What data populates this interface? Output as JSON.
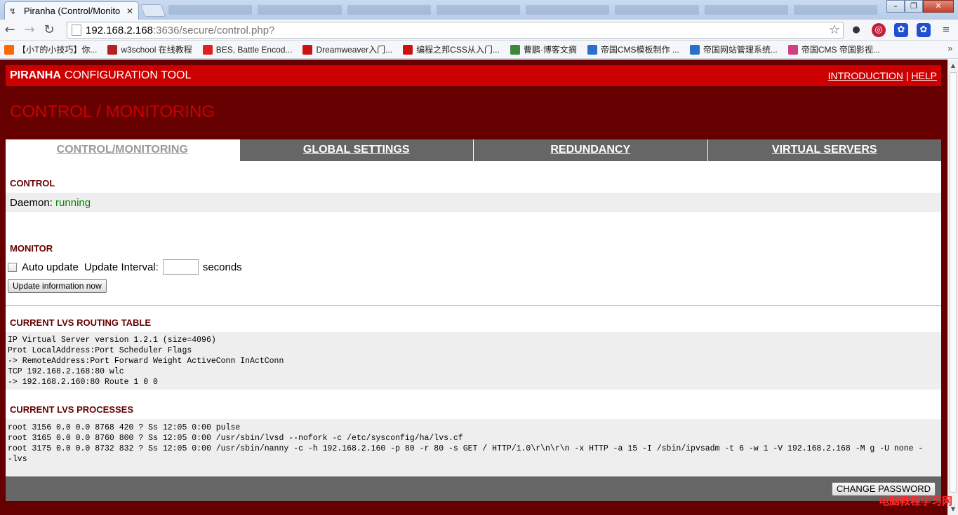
{
  "browser": {
    "tab_title": "Piranha (Control/Monito",
    "url_host": "192.168.2.168",
    "url_rest": ":3636/secure/control.php?"
  },
  "bookmarks": [
    {
      "label": "【小T的小技巧】你...",
      "color": "#ff6600"
    },
    {
      "label": "w3school 在线教程",
      "color": "#b22222"
    },
    {
      "label": "BES, Battle Encod...",
      "color": "#e02020"
    },
    {
      "label": "Dreamweaver入门...",
      "color": "#cc1111"
    },
    {
      "label": "编程之邦CSS从入门...",
      "color": "#cc1111"
    },
    {
      "label": "曹鹏·博客文摘",
      "color": "#3a8a3a"
    },
    {
      "label": "帝国CMS模板制作 ...",
      "color": "#2a6fd0"
    },
    {
      "label": "帝国网站管理系统...",
      "color": "#2a6fd0"
    },
    {
      "label": "帝国CMS 帝国影视...",
      "color": "#d04080"
    }
  ],
  "header": {
    "brand": "PIRANHA",
    "title": "CONFIGURATION TOOL",
    "link_intro": "INTRODUCTION",
    "separator": "|",
    "link_help": "HELP"
  },
  "page_title": "CONTROL / MONITORING",
  "tabs": [
    {
      "label": "CONTROL/MONITORING"
    },
    {
      "label": "GLOBAL SETTINGS"
    },
    {
      "label": "REDUNDANCY"
    },
    {
      "label": "VIRTUAL SERVERS"
    }
  ],
  "control": {
    "heading": "CONTROL",
    "daemon_label": "Daemon:",
    "daemon_status": "running"
  },
  "monitor": {
    "heading": "MONITOR",
    "auto_update_label": "Auto update",
    "interval_label": "Update Interval:",
    "interval_value": "",
    "seconds_label": "seconds",
    "update_button": "Update information now"
  },
  "routing": {
    "heading": "CURRENT LVS ROUTING TABLE",
    "lines": [
      "IP Virtual Server version 1.2.1 (size=4096)",
      "Prot LocalAddress:Port Scheduler Flags",
      "-> RemoteAddress:Port Forward Weight ActiveConn InActConn",
      "TCP 192.168.2.168:80 wlc",
      "-> 192.168.2.160:80 Route 1 0 0"
    ]
  },
  "processes": {
    "heading": "CURRENT LVS PROCESSES",
    "lines": [
      "root 3156 0.0 0.0 8768 420 ? Ss 12:05 0:00 pulse",
      "root 3165 0.0 0.0 8760 800 ? Ss 12:05 0:00 /usr/sbin/lvsd --nofork -c /etc/sysconfig/ha/lvs.cf",
      "root 3175 0.0 0.0 8732 832 ? Ss 12:05 0:00 /usr/sbin/nanny -c -h 192.168.2.160 -p 80 -r 80 -s GET / HTTP/1.0\\r\\n\\r\\n -x HTTP -a 15 -I /sbin/ipvsadm -t 6 -w 1 -V 192.168.2.168 -M g -U none -",
      "-lvs"
    ]
  },
  "footer": {
    "change_password": "CHANGE PASSWORD"
  },
  "watermark": "电脑教程学习网"
}
